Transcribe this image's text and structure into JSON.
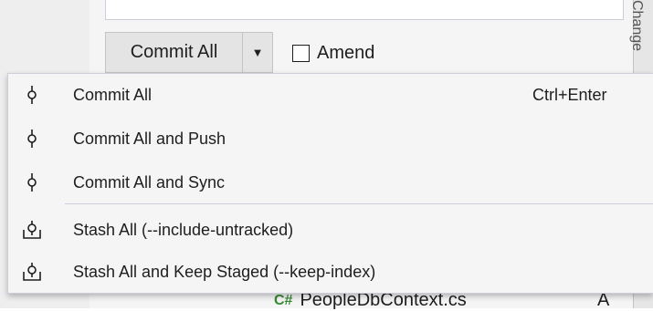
{
  "commit_bar": {
    "commit_all_label": "Commit All",
    "dropdown_arrow": "▼",
    "amend_label": "Amend",
    "amend_checked": false
  },
  "right_tab": {
    "label": "Change"
  },
  "commit_menu": {
    "items": [
      {
        "label": "Commit All",
        "shortcut": "Ctrl+Enter",
        "icon": "git-commit-icon"
      },
      {
        "label": "Commit All and Push",
        "shortcut": "",
        "icon": "git-commit-icon"
      },
      {
        "label": "Commit All and Sync",
        "shortcut": "",
        "icon": "git-commit-icon"
      },
      {
        "label": "Stash All (--include-untracked)",
        "shortcut": "",
        "icon": "git-stash-icon"
      },
      {
        "label": "Stash All and Keep Staged (--keep-index)",
        "shortcut": "",
        "icon": "git-stash-icon"
      }
    ]
  },
  "changes_list": {
    "visible_file": "PeopleDbContext.cs",
    "visible_file_status": "A",
    "visible_file_icon": "csharp-file-icon"
  },
  "colors": {
    "menu_background": "#f5f5f5",
    "menu_border": "#cccedb",
    "separator": "#cccedb",
    "button_background": "#e4e4e4",
    "csharp_icon": "#388a34"
  }
}
